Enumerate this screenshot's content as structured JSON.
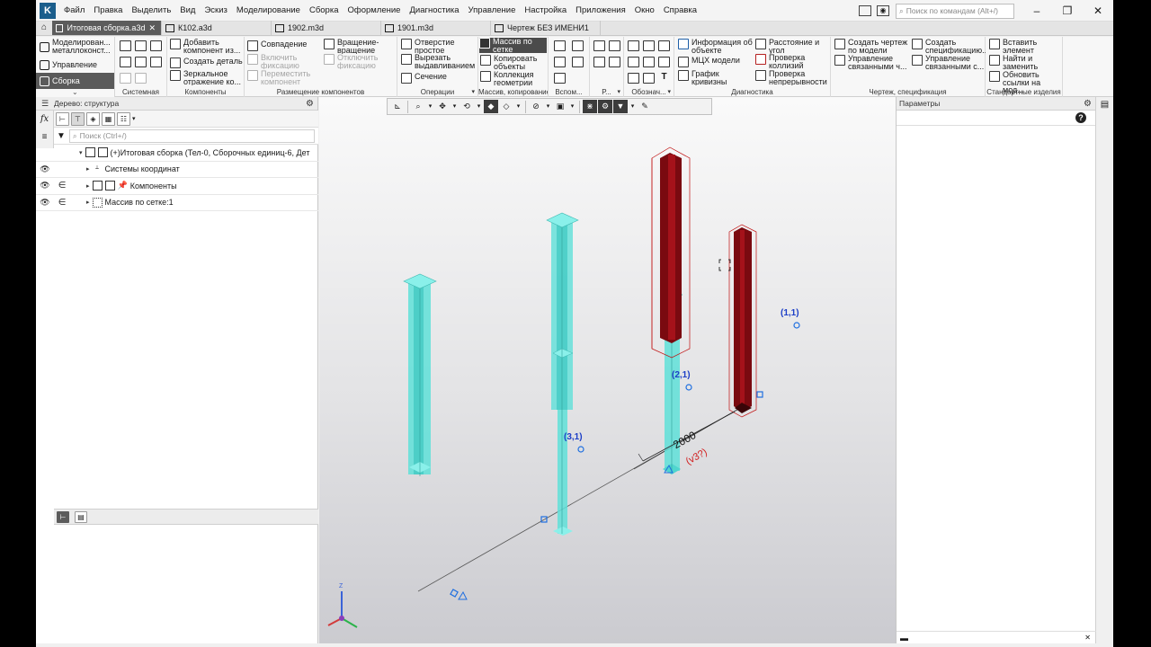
{
  "menu": [
    "Файл",
    "Правка",
    "Выделить",
    "Вид",
    "Эскиз",
    "Моделирование",
    "Сборка",
    "Оформление",
    "Диагностика",
    "Управление",
    "Настройка",
    "Приложения",
    "Окно",
    "Справка"
  ],
  "command_search_placeholder": "Поиск по командам (Alt+/)",
  "window_controls": [
    "–",
    "❐",
    "✕"
  ],
  "tabs": [
    {
      "label": "Итоговая сборка.a3d",
      "active": true
    },
    {
      "label": "К102.a3d",
      "active": false
    },
    {
      "label": "1902.m3d",
      "active": false
    },
    {
      "label": "1901.m3d",
      "active": false
    },
    {
      "label": "Чертеж БЕЗ ИМЕНИ1",
      "active": false
    }
  ],
  "ribbon_left": {
    "items": [
      "Моделирован... металлоконст...",
      "Управление",
      "Сборка"
    ]
  },
  "ribbon": {
    "groups": {
      "system": "Системная",
      "components": "Компоненты",
      "placement": "Размещение компонентов",
      "operations": "Операции",
      "array": "Массив, копирование",
      "aux": "Вспом...",
      "r": "Р...",
      "designations": "Обознач...",
      "diagnostics": "Диагностика",
      "drawing": "Чертеж, спецификация",
      "standard": "Стандартные изделия"
    },
    "buttons": {
      "add_component": "Добавить компонент из...",
      "create_part": "Создать деталь",
      "mirror": "Зеркальное отражение ко...",
      "coincidence": "Совпадение",
      "enable_fix": "Включить фиксацию",
      "move_component": "Переместить компонент",
      "rotation": "Вращение-вращение",
      "disable_fix": "Отключить фиксацию",
      "hole": "Отверстие простое",
      "extrude_cut": "Вырезать выдавливанием",
      "section": "Сечение",
      "grid_array": "Массив по сетке",
      "copy_objects": "Копировать объекты",
      "geometry_collection": "Коллекция геометрии",
      "object_info": "Информация об объекте",
      "mcx": "МЦХ модели",
      "curvature": "График кривизны",
      "distance_angle": "Расстояние и угол",
      "collision_check": "Проверка коллизий",
      "continuity_check": "Проверка непрерывности",
      "create_drawing": "Создать чертеж по модели",
      "manage_linked": "Управление связанными ч...",
      "create_spec": "Создать спецификацию...",
      "manage_linked_spec": "Управление связанными с...",
      "insert_element": "Вставить элемент",
      "find_replace": "Найти и заменить",
      "update_links": "Обновить ссылки на мод..."
    }
  },
  "tree_panel": {
    "title": "Дерево: структура",
    "search_placeholder": "Поиск (Ctrl+/)",
    "rows": [
      {
        "label": "(+)Итоговая сборка (Тел-0, Сборочных единиц-6, Дет",
        "eye": false
      },
      {
        "label": "Системы координат",
        "eye": true
      },
      {
        "label": "Компоненты",
        "eye": true
      },
      {
        "label": "Массив по сетке:1",
        "eye": true
      }
    ]
  },
  "params_panel": {
    "title": "Параметры"
  },
  "viewport": {
    "labels": {
      "p11": "(1,1)",
      "p21": "(2,1)",
      "p31": "(3,1)",
      "dim_value": "2000",
      "dim_count": "(v3?)",
      "axis_z": "Z"
    },
    "colors": {
      "column_cyan": "#5fe0d8",
      "column_red": "#7a0a10",
      "label_blue": "#1d3fc7",
      "dim_red": "#d21c1c"
    }
  }
}
